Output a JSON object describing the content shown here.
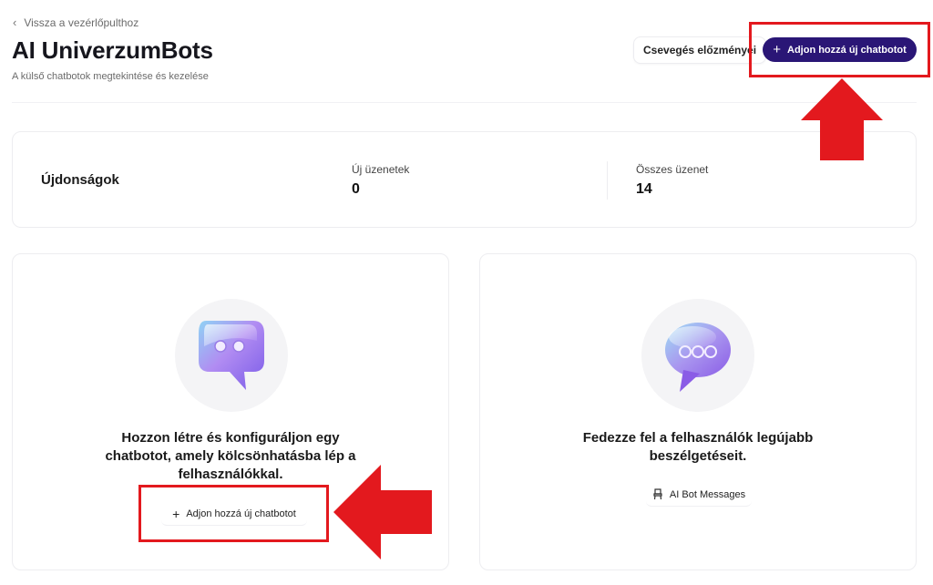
{
  "header": {
    "back_label": "Vissza a vezérlőpulthoz",
    "title": "AI UniverzumBots",
    "subtitle": "A külső chatbotok megtekintése és kezelése",
    "history_button": "Csevegés előzményei",
    "add_button": "Adjon hozzá új chatbotot"
  },
  "stats": {
    "title": "Újdonságok",
    "items": [
      {
        "label": "Új üzenetek",
        "value": "0"
      },
      {
        "label": "Összes üzenet",
        "value": "14"
      }
    ]
  },
  "cards": {
    "create": {
      "text": "Hozzon létre és konfiguráljon egy chatbotot, amely kölcsönhatásba lép a felhasználókkal.",
      "button": "Adjon hozzá új chatbotot",
      "icon": "chat-bubble-dots-icon"
    },
    "explore": {
      "text": "Fedezze fel a felhasználók legújabb beszélgetéseit.",
      "button": "AI Bot Messages",
      "icon": "chat-bubble-ellipsis-icon"
    }
  },
  "annotations": {
    "highlight_color": "#e3191e",
    "accent_color": "#2a1676"
  }
}
